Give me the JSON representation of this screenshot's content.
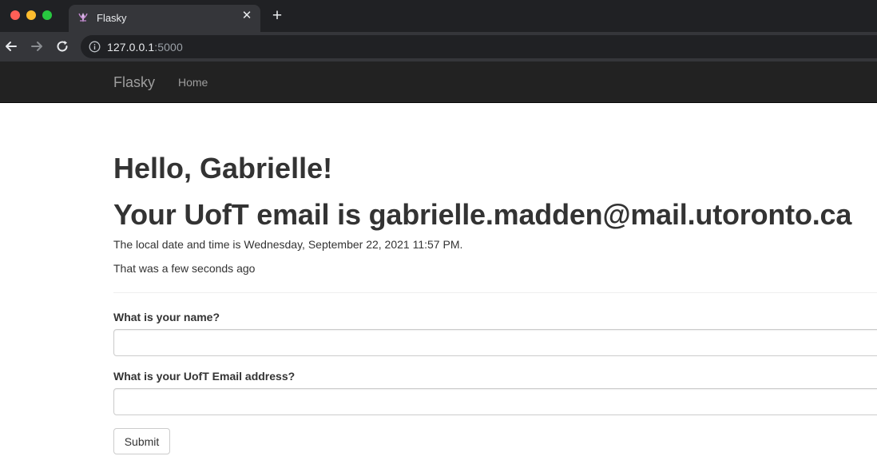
{
  "browser": {
    "tab_title": "Flasky",
    "tab_favicon": "flask-logo-icon",
    "url_host": "127.0.0.1",
    "url_port": ":5000",
    "icons": {
      "back": "arrow-left-icon",
      "forward": "arrow-right-icon",
      "reload": "reload-icon",
      "site_info": "info-icon",
      "close": "close-icon",
      "new_tab": "plus-icon"
    },
    "close_glyph": "✕",
    "new_tab_glyph": "+"
  },
  "navbar": {
    "brand": "Flasky",
    "items": [
      {
        "label": "Home"
      }
    ]
  },
  "main": {
    "greeting": "Hello, Gabrielle!",
    "email_heading": "Your UofT email is gabrielle.madden@mail.utoronto.ca",
    "datetime_text": "The local date and time is Wednesday, September 22, 2021 11:57 PM.",
    "relative_time": "That was a few seconds ago"
  },
  "form": {
    "name_label": "What is your name?",
    "name_value": "",
    "email_label": "What is your UofT Email address?",
    "email_value": "",
    "submit_label": "Submit"
  },
  "colors": {
    "chrome_tabstrip": "#202124",
    "chrome_toolbar": "#35363a",
    "navbar_bg": "#222222",
    "navbar_text": "#9d9d9d",
    "body_text": "#333333"
  }
}
